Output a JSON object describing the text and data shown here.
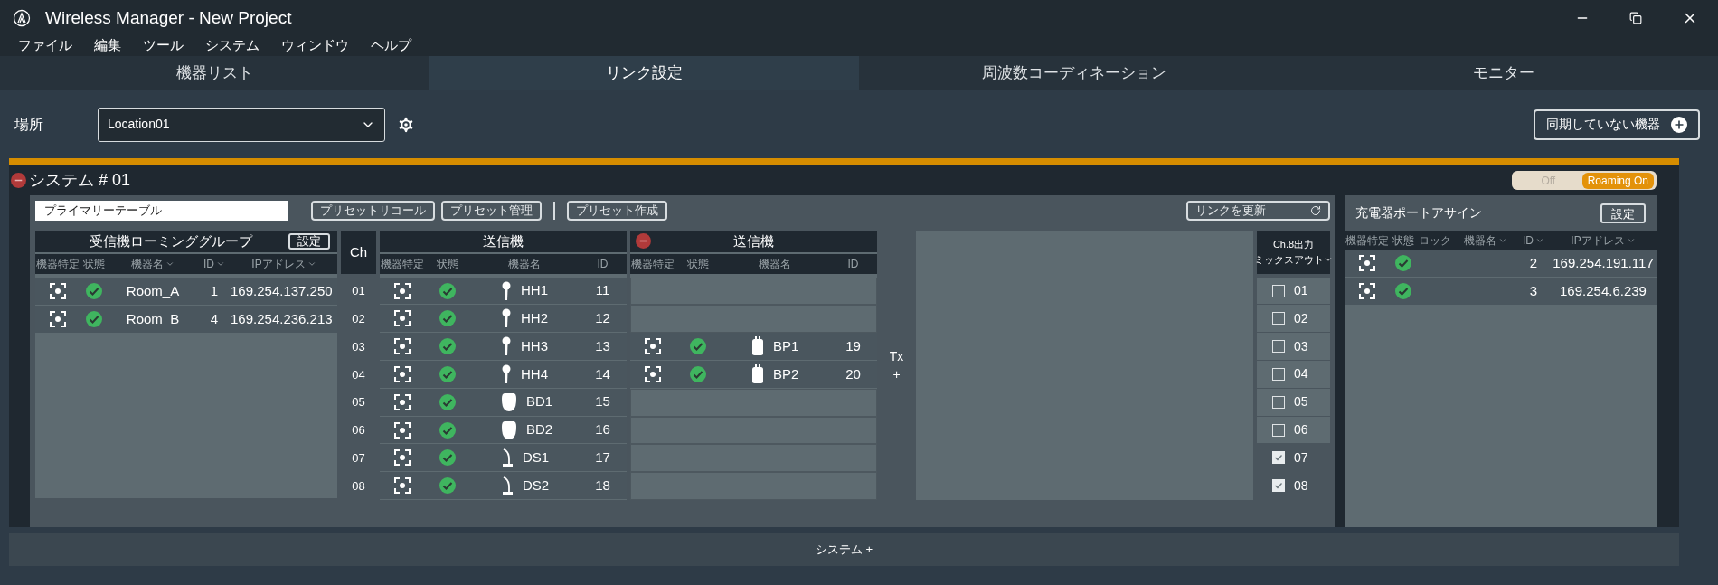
{
  "window": {
    "title": "Wireless Manager - New Project"
  },
  "menu": [
    "ファイル",
    "編集",
    "ツール",
    "システム",
    "ウィンドウ",
    "ヘルプ"
  ],
  "tabs": [
    {
      "label": "機器リスト",
      "selected": false
    },
    {
      "label": "リンク設定",
      "selected": true
    },
    {
      "label": "周波数コーディネーション",
      "selected": false
    },
    {
      "label": "モニター",
      "selected": false
    }
  ],
  "location": {
    "label": "場所",
    "value": "Location01"
  },
  "unsynced_button": "同期していない機器",
  "system": {
    "title": "システム # 01",
    "removable": true,
    "roaming": {
      "off_label": "Off",
      "on_label": "Roaming On",
      "on": true
    },
    "preset_table": "プライマリーテーブル",
    "preset_buttons": [
      "プリセットリコール",
      "プリセット管理"
    ],
    "preset_create_button": "プリセット作成",
    "update_link_button": "リンクを更新",
    "roaming_group": {
      "title": "受信機ローミンググループ",
      "settings_button": "設定",
      "columns": [
        {
          "label": "機器特定",
          "sortable": false
        },
        {
          "label": "状態",
          "sortable": false
        },
        {
          "label": "機器名",
          "sortable": true
        },
        {
          "label": "ID",
          "sortable": true
        },
        {
          "label": "IPアドレス",
          "sortable": true
        }
      ],
      "rows": [
        {
          "name": "Room_A",
          "id": "1",
          "ip": "169.254.137.250",
          "online": true
        },
        {
          "name": "Room_B",
          "id": "4",
          "ip": "169.254.236.213",
          "online": true
        }
      ]
    },
    "channel_header": "Ch",
    "channels": [
      "01",
      "02",
      "03",
      "04",
      "05",
      "06",
      "07",
      "08"
    ],
    "transmitters": [
      {
        "title": "送信機",
        "removable": false,
        "columns": [
          "機器特定",
          "状態",
          "機器名",
          "ID"
        ],
        "rows": [
          {
            "kind": "handheld",
            "name": "HH1",
            "id": "11",
            "online": true
          },
          {
            "kind": "handheld",
            "name": "HH2",
            "id": "12",
            "online": true
          },
          {
            "kind": "handheld",
            "name": "HH3",
            "id": "13",
            "online": true
          },
          {
            "kind": "handheld",
            "name": "HH4",
            "id": "14",
            "online": true
          },
          {
            "kind": "boundary",
            "name": "BD1",
            "id": "15",
            "online": true
          },
          {
            "kind": "boundary",
            "name": "BD2",
            "id": "16",
            "online": true
          },
          {
            "kind": "gooseneck",
            "name": "DS1",
            "id": "17",
            "online": true
          },
          {
            "kind": "gooseneck",
            "name": "DS2",
            "id": "18",
            "online": true
          }
        ]
      },
      {
        "title": "送信機",
        "removable": true,
        "columns": [
          "機器特定",
          "状態",
          "機器名",
          "ID"
        ],
        "rows": [
          {
            "kind": "empty"
          },
          {
            "kind": "empty"
          },
          {
            "kind": "bodypack",
            "name": "BP1",
            "id": "19",
            "online": true
          },
          {
            "kind": "bodypack",
            "name": "BP2",
            "id": "20",
            "online": true
          },
          {
            "kind": "empty"
          },
          {
            "kind": "empty"
          },
          {
            "kind": "empty"
          },
          {
            "kind": "empty"
          }
        ]
      }
    ],
    "tx_add": {
      "label": "Tx",
      "sign": "+"
    },
    "mix_out": {
      "title": "Ch.8出力",
      "dropdown": "ミックスアウト",
      "channels": [
        {
          "label": "01",
          "checked": false
        },
        {
          "label": "02",
          "checked": false
        },
        {
          "label": "03",
          "checked": false
        },
        {
          "label": "04",
          "checked": false
        },
        {
          "label": "05",
          "checked": false
        },
        {
          "label": "06",
          "checked": false
        },
        {
          "label": "07",
          "checked": true
        },
        {
          "label": "08",
          "checked": true
        }
      ]
    },
    "charger": {
      "title": "充電器ポートアサイン",
      "settings_button": "設定",
      "columns": [
        {
          "label": "機器特定",
          "sortable": false
        },
        {
          "label": "状態",
          "sortable": false
        },
        {
          "label": "ロック",
          "sortable": false
        },
        {
          "label": "機器名",
          "sortable": true
        },
        {
          "label": "ID",
          "sortable": true
        },
        {
          "label": "IPアドレス",
          "sortable": true
        }
      ],
      "rows": [
        {
          "id": "2",
          "ip": "169.254.191.117",
          "online": true
        },
        {
          "id": "3",
          "ip": "169.254.6.239",
          "online": true
        }
      ]
    }
  },
  "add_system_button": "システム +"
}
